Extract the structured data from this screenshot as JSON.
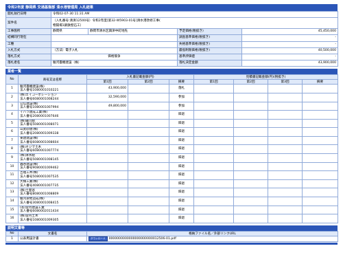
{
  "page_title": "令和2年度 静岡県 交通基盤部 清水港管理局 入札結果",
  "info": {
    "exec_date_label": "開札執行日時",
    "exec_date_value": "令和02-07-30 11:31 AM",
    "case_label": "案件名",
    "case_value_1": "（入札番号:清清12500号）令和2年度[第32-W5903-01号]清水港改修工事(",
    "case_value_2": "物揚場1鋼鉄壁石工）",
    "site_label": "工事箇所",
    "site_value_a": "静岡県",
    "site_value_b": "静岡市清水区興津中町地先",
    "jv_label": "結構同行現在",
    "type_label": "工種",
    "method_label": "入札方式",
    "method_value": "（方法）電子入札",
    "award_label": "落札方式",
    "award_value": "価格競争",
    "winner_label": "落札者名",
    "winner_value": "駿河臺機建設（株）",
    "right_rows": [
      {
        "label": "予定価格(税抜き)",
        "value": "45,450,000"
      },
      {
        "label": "調査基準価格(税抜き)",
        "value": "-"
      },
      {
        "label": "失格基準価格(税抜き)",
        "value": "-"
      },
      {
        "label": "最低制限価格(税抜き)",
        "value": "40,500,000"
      },
      {
        "label": "基準評価値",
        "value": "-"
      },
      {
        "label": "落札決定金額",
        "value": "43,900,000"
      }
    ]
  },
  "bidders_section_title": "業者一覧",
  "bidders_headers": {
    "no": "No",
    "name": "商号又は名称",
    "bid_amount": "入札書記載金額(円)",
    "bid_round1": "第1回",
    "bid_round2": "第2回",
    "remarks": "摘要",
    "competitive": "見積書記載金額(円)(税抜き)",
    "comp_round1": "第1回",
    "comp_round2": "第2回",
    "comp_round3": "第3回",
    "comp_remarks": "摘要"
  },
  "bidders": [
    {
      "no": "1",
      "name": "駿河臺機建設(株)",
      "corp": "法人番号1080001010221",
      "r1": "43,900,000",
      "remark": "落札"
    },
    {
      "no": "2",
      "name": "(株)エイコーポレーション",
      "corp": "法人番号6080001008244",
      "r1": "32,590,000",
      "remark": "参加"
    },
    {
      "no": "3",
      "name": "公信建設(株)",
      "corp": "法人番号1080001007994",
      "r1": "49,800,000",
      "remark": "参加"
    },
    {
      "no": "4",
      "name": "イハラ建成工業(株)",
      "corp": "法人番号2080001007646",
      "r1": "",
      "remark": "辞退"
    },
    {
      "no": "5",
      "name": "(株)鐵川組",
      "corp": "法人番号5080001008071",
      "r1": "",
      "remark": "辞退"
    },
    {
      "no": "6",
      "name": "山武砂建(株)",
      "corp": "法人番号2080001009338",
      "r1": "",
      "remark": "辞退"
    },
    {
      "no": "7",
      "name": "東建建設(株)",
      "corp": "法人番号6080001008604",
      "r1": "",
      "remark": "辞退"
    },
    {
      "no": "8",
      "name": "(株)オジマ土木",
      "corp": "法人番号6080001007774",
      "r1": "",
      "remark": "辞退"
    },
    {
      "no": "9",
      "name": "(株)清水組",
      "corp": "法人番号5080001008145",
      "r1": "",
      "remark": "辞退"
    },
    {
      "no": "10",
      "name": "銭谷建設(株)",
      "corp": "法人番号9080001009462",
      "r1": "",
      "remark": "辞退"
    },
    {
      "no": "11",
      "name": "吉福工木(株)",
      "corp": "法人番号5080001007535",
      "r1": "",
      "remark": "辞退"
    },
    {
      "no": "12",
      "name": "大橋工業(株)",
      "corp": "法人番号4080001007735",
      "r1": "",
      "remark": "辞退"
    },
    {
      "no": "13",
      "name": "(株)土屋谷",
      "corp": "法人番号8080001008809",
      "r1": "",
      "remark": "辞退"
    },
    {
      "no": "14",
      "name": "駿河梁地造成(株)",
      "corp": "法人番号3080001008415",
      "r1": "",
      "remark": "辞退"
    },
    {
      "no": "15",
      "name": "(有)望月建設工業",
      "corp": "法人番号6080002011434",
      "r1": "",
      "remark": "辞退"
    },
    {
      "no": "16",
      "name": "(株)望月土木",
      "corp": "法人番号1080001009305",
      "r1": "",
      "remark": "辞退"
    }
  ],
  "docs_section_title": "説明文書等",
  "docs_headers": {
    "no": "No",
    "name": "文書名",
    "file": "格納ファイル名／外部リンクURL"
  },
  "docs": [
    {
      "no": "1",
      "name": "公表用設計書",
      "button": "ダウンロード",
      "file": "0000000000000000000000012506-01.pdf"
    }
  ]
}
